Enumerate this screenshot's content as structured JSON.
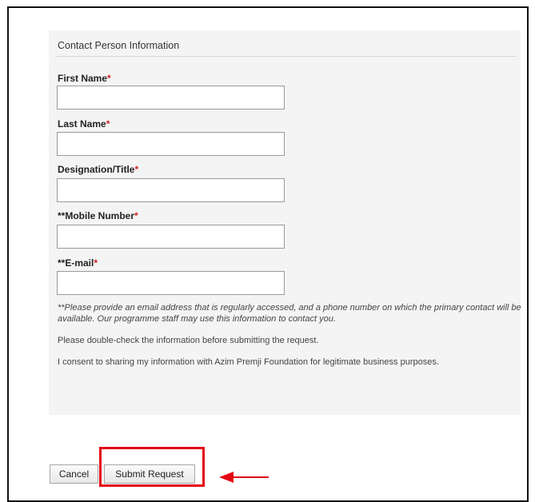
{
  "section": {
    "title": "Contact Person Information"
  },
  "fields": [
    {
      "label": "First Name",
      "value": ""
    },
    {
      "label": "Last Name",
      "value": ""
    },
    {
      "label": "Designation/Title",
      "value": ""
    },
    {
      "label": "**Mobile Number",
      "value": ""
    },
    {
      "label": "**E-mail",
      "value": ""
    }
  ],
  "required_marker": "*",
  "notes": {
    "contact_note": "**Please provide an email address that is regularly accessed, and a phone number on which the primary contact will be available. Our programme staff may use this information to contact you.",
    "double_check": "Please double-check the information before submitting the request.",
    "consent": "I consent to sharing my information with Azim Premji Foundation for legitimate business purposes."
  },
  "buttons": {
    "cancel_label": "Cancel",
    "submit_label": "Submit Request"
  },
  "colors": {
    "required": "#cc2222",
    "annotation": "#e30613",
    "panel_background": "#f4f4f4"
  }
}
